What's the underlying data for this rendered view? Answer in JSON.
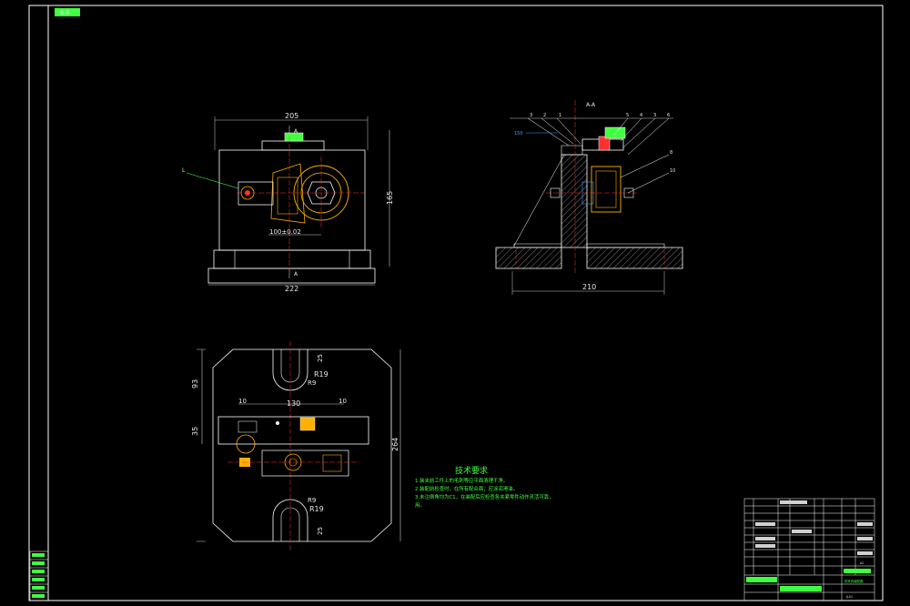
{
  "drawing": {
    "corner_tag": "B-B",
    "section_label": "A-A",
    "front_view": {
      "dim_top": "205",
      "dim_bottom": "222",
      "dim_right": "165",
      "dim_center": "100±0.02",
      "arrow_label_top": "A",
      "arrow_label_bottom": "A",
      "leader_label": "L"
    },
    "section_view": {
      "dim_bottom": "210",
      "callouts_top": [
        "3",
        "2",
        "1",
        "5",
        "4",
        "3",
        "6"
      ],
      "callouts_right": [
        "8",
        "10"
      ],
      "tol_note": "150"
    },
    "top_view": {
      "dim_top_r": "R19",
      "dim_top_r_small": "R9",
      "dim_top_25": "25",
      "dim_left_93": "93",
      "dim_left_35": "35",
      "dim_width_130": "130",
      "dim_10_left": "10",
      "dim_10_right": "10",
      "dim_height_264": "264",
      "dim_bottom_r": "R19",
      "dim_bottom_r_small": "R9",
      "dim_bottom_25": "25"
    },
    "tech_notes": {
      "title": "技术要求",
      "lines": [
        "1.装夹前工件上的毛刺等应平面清理干净。",
        "2.装配前检查时，在所有配合面，应涂润滑油。",
        "3.未注倒角均为C1，在装配后应检查各夹紧零件动作灵活可靠，",
        "用。"
      ]
    },
    "title_block": {
      "part_name": "铣夹具装配图",
      "drawing_no": "JJ-01",
      "sheet": "A2"
    }
  }
}
